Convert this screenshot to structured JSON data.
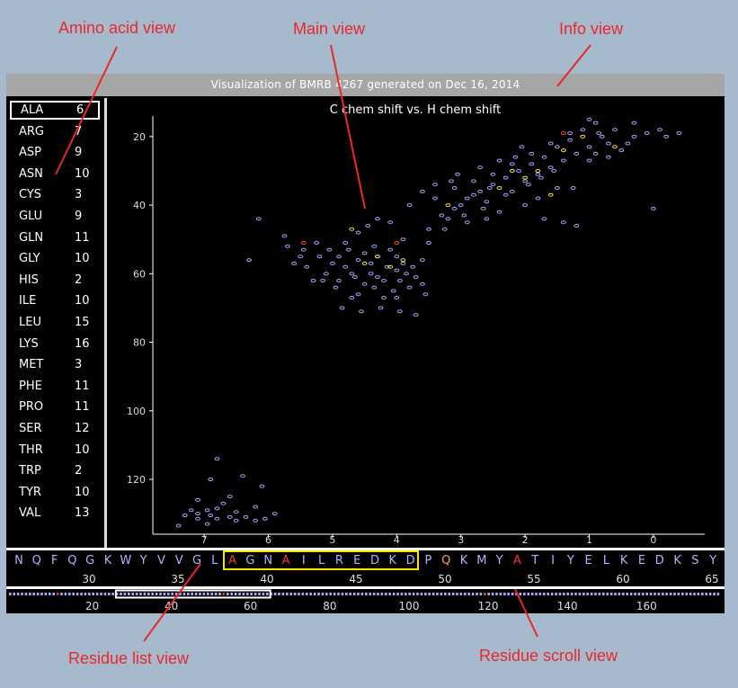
{
  "annotations": {
    "amino_acid_view": "Amino acid view",
    "main_view": "Main view",
    "info_view": "Info view",
    "residue_list_view": "Residue list view",
    "residue_scroll_view": "Residue scroll view"
  },
  "info": {
    "title": "Visualization of BMRB 4267 generated on Dec 16, 2014"
  },
  "amino_acids": [
    {
      "name": "ALA",
      "count": "6",
      "selected": true
    },
    {
      "name": "ARG",
      "count": "7"
    },
    {
      "name": "ASP",
      "count": "9"
    },
    {
      "name": "ASN",
      "count": "10"
    },
    {
      "name": "CYS",
      "count": "3"
    },
    {
      "name": "GLU",
      "count": "9"
    },
    {
      "name": "GLN",
      "count": "11"
    },
    {
      "name": "GLY",
      "count": "10"
    },
    {
      "name": "HIS",
      "count": "2"
    },
    {
      "name": "ILE",
      "count": "10"
    },
    {
      "name": "LEU",
      "count": "15"
    },
    {
      "name": "LYS",
      "count": "16"
    },
    {
      "name": "MET",
      "count": "3"
    },
    {
      "name": "PHE",
      "count": "11"
    },
    {
      "name": "PRO",
      "count": "11"
    },
    {
      "name": "SER",
      "count": "12"
    },
    {
      "name": "THR",
      "count": "10"
    },
    {
      "name": "TRP",
      "count": "2"
    },
    {
      "name": "TYR",
      "count": "10"
    },
    {
      "name": "VAL",
      "count": "13"
    }
  ],
  "chart_data": {
    "type": "scatter",
    "title": "C chem shift vs. H chem shift",
    "xlim": [
      7.8,
      -0.8
    ],
    "ylim": [
      14,
      136
    ],
    "x_ticks": [
      "7",
      "6",
      "5",
      "4",
      "3",
      "2",
      "1",
      "0"
    ],
    "y_ticks": [
      "20",
      "40",
      "60",
      "80",
      "100",
      "120"
    ],
    "colors": {
      "default": "#a8a8ff",
      "highlight": "#ffe34d",
      "selected": "#ff4a2e"
    },
    "series": [
      {
        "values": [
          [
            6.8,
            114
          ],
          [
            6.4,
            119
          ],
          [
            6.9,
            120
          ],
          [
            6.1,
            122
          ],
          [
            6.6,
            125
          ],
          [
            7.1,
            126
          ],
          [
            6.7,
            127
          ],
          [
            6.2,
            128
          ],
          [
            6.8,
            128.5
          ],
          [
            7.2,
            129
          ],
          [
            6.95,
            129
          ],
          [
            6.5,
            129.5
          ],
          [
            7.1,
            130
          ],
          [
            6.9,
            130.5
          ],
          [
            7.3,
            130.5
          ],
          [
            5.9,
            130
          ],
          [
            6.35,
            131
          ],
          [
            6.6,
            131
          ],
          [
            6.8,
            131.5
          ],
          [
            7.1,
            131.5
          ],
          [
            6.05,
            131.5
          ],
          [
            6.2,
            132
          ],
          [
            7.4,
            133.5
          ],
          [
            6.95,
            133
          ],
          [
            6.5,
            132
          ]
        ]
      },
      {
        "values": [
          [
            6.15,
            44
          ],
          [
            5.7,
            52
          ],
          [
            6.3,
            56
          ],
          [
            5.5,
            55
          ],
          [
            5.2,
            55
          ],
          [
            5.0,
            57
          ],
          [
            4.8,
            58
          ],
          [
            4.6,
            56
          ],
          [
            4.4,
            60
          ],
          [
            4.2,
            62
          ],
          [
            4.0,
            59
          ],
          [
            3.8,
            64
          ],
          [
            3.6,
            63
          ],
          [
            4.5,
            54
          ],
          [
            4.3,
            55
          ],
          [
            4.1,
            53
          ],
          [
            3.9,
            57
          ],
          [
            3.7,
            61
          ],
          [
            5.4,
            58
          ],
          [
            5.1,
            60
          ],
          [
            4.9,
            62
          ],
          [
            4.7,
            60
          ],
          [
            4.5,
            63
          ],
          [
            4.3,
            61
          ],
          [
            4.05,
            65
          ],
          [
            3.85,
            60
          ],
          [
            4.6,
            66
          ],
          [
            4.2,
            67
          ],
          [
            3.95,
            62
          ],
          [
            4.4,
            57
          ],
          [
            4.75,
            53
          ],
          [
            5.05,
            53
          ],
          [
            5.3,
            62
          ],
          [
            5.6,
            57
          ],
          [
            4.85,
            70
          ],
          [
            4.55,
            71
          ],
          [
            4.25,
            70
          ],
          [
            3.95,
            71
          ],
          [
            3.7,
            72
          ],
          [
            4.6,
            48
          ],
          [
            4.3,
            44
          ],
          [
            4.1,
            45
          ],
          [
            4.0,
            55
          ],
          [
            3.5,
            51
          ],
          [
            3.6,
            56
          ],
          [
            4.8,
            51
          ],
          [
            4.45,
            46
          ],
          [
            4.95,
            64
          ],
          [
            4.15,
            58
          ],
          [
            3.75,
            58
          ],
          [
            4.65,
            61
          ],
          [
            4.35,
            64
          ],
          [
            3.55,
            66
          ],
          [
            4.0,
            67
          ],
          [
            5.45,
            53
          ],
          [
            5.25,
            51
          ],
          [
            5.75,
            49
          ],
          [
            5.15,
            62
          ],
          [
            4.9,
            55
          ],
          [
            4.7,
            67
          ],
          [
            4.35,
            52
          ],
          [
            3.9,
            50
          ]
        ]
      },
      {
        "values": [
          [
            3.5,
            47
          ],
          [
            3.2,
            44
          ],
          [
            3.0,
            40
          ],
          [
            2.8,
            37
          ],
          [
            2.6,
            39
          ],
          [
            2.4,
            42
          ],
          [
            2.2,
            36
          ],
          [
            2.0,
            33
          ],
          [
            1.8,
            31
          ],
          [
            1.6,
            29
          ],
          [
            1.4,
            27
          ],
          [
            1.2,
            25
          ],
          [
            1.0,
            23
          ],
          [
            0.8,
            20
          ],
          [
            0.6,
            18
          ],
          [
            0.9,
            16
          ],
          [
            1.1,
            18
          ],
          [
            1.3,
            21
          ],
          [
            1.5,
            23
          ],
          [
            1.7,
            26
          ],
          [
            1.9,
            28
          ],
          [
            2.1,
            30
          ],
          [
            2.3,
            32
          ],
          [
            2.5,
            34
          ],
          [
            2.7,
            36
          ],
          [
            2.9,
            38
          ],
          [
            3.1,
            41
          ],
          [
            3.3,
            43
          ],
          [
            3.4,
            38
          ],
          [
            3.1,
            35
          ],
          [
            2.8,
            33
          ],
          [
            2.5,
            31
          ],
          [
            2.2,
            28
          ],
          [
            1.9,
            25
          ],
          [
            1.6,
            22
          ],
          [
            1.3,
            19
          ],
          [
            1.0,
            15
          ],
          [
            0.7,
            22
          ],
          [
            0.5,
            24
          ],
          [
            0.3,
            20
          ],
          [
            0.1,
            19
          ],
          [
            -0.1,
            18
          ],
          [
            -0.2,
            20
          ],
          [
            -0.4,
            19
          ],
          [
            0.0,
            41
          ],
          [
            2.0,
            40
          ],
          [
            1.7,
            44
          ],
          [
            1.4,
            45
          ],
          [
            1.2,
            46
          ],
          [
            1.8,
            38
          ],
          [
            2.3,
            37
          ],
          [
            2.6,
            44
          ],
          [
            2.9,
            45
          ],
          [
            1.5,
            35
          ],
          [
            1.0,
            27
          ],
          [
            0.7,
            26
          ],
          [
            0.4,
            22
          ],
          [
            2.4,
            27
          ],
          [
            2.7,
            29
          ],
          [
            3.05,
            31
          ],
          [
            3.4,
            34
          ],
          [
            3.6,
            36
          ],
          [
            3.8,
            40
          ],
          [
            2.05,
            23
          ],
          [
            1.55,
            30
          ],
          [
            2.95,
            43
          ],
          [
            3.25,
            47
          ],
          [
            0.9,
            25
          ],
          [
            0.3,
            16
          ],
          [
            1.95,
            34
          ],
          [
            2.55,
            35
          ],
          [
            2.15,
            26
          ],
          [
            1.75,
            32
          ],
          [
            3.15,
            33
          ],
          [
            2.65,
            41
          ],
          [
            1.25,
            35
          ],
          [
            0.85,
            19
          ]
        ]
      },
      {
        "kind": "highlight",
        "values": [
          [
            4.7,
            47
          ],
          [
            4.3,
            55
          ],
          [
            4.1,
            58
          ],
          [
            3.9,
            56
          ],
          [
            3.2,
            40
          ],
          [
            2.4,
            35
          ],
          [
            2.2,
            30
          ],
          [
            2.0,
            32
          ],
          [
            1.8,
            30
          ],
          [
            1.4,
            24
          ],
          [
            1.1,
            20
          ],
          [
            0.6,
            23
          ],
          [
            1.6,
            37
          ],
          [
            4.5,
            57
          ]
        ]
      },
      {
        "kind": "selected",
        "values": [
          [
            5.45,
            51
          ],
          [
            4.0,
            51
          ],
          [
            1.4,
            19
          ]
        ]
      }
    ]
  },
  "residue_list": {
    "residues": [
      {
        "code": "N",
        "color": "#b2b2ff"
      },
      {
        "code": "Q",
        "color": "#b2b2ff"
      },
      {
        "code": "F",
        "color": "#b2b2ff"
      },
      {
        "code": "Q",
        "color": "#b2b2ff"
      },
      {
        "code": "G",
        "color": "#b2b2ff"
      },
      {
        "code": "K",
        "color": "#b2b2ff"
      },
      {
        "code": "W",
        "color": "#b2b2ff"
      },
      {
        "code": "Y",
        "color": "#b2b2ff"
      },
      {
        "code": "V",
        "color": "#b2b2ff"
      },
      {
        "code": "V",
        "color": "#b2b2ff"
      },
      {
        "code": "G",
        "color": "#b2b2ff"
      },
      {
        "code": "L",
        "color": "#b2b2ff"
      },
      {
        "code": "A",
        "color": "#ff3030"
      },
      {
        "code": "G",
        "color": "#b2b2ff"
      },
      {
        "code": "N",
        "color": "#b2b2ff"
      },
      {
        "code": "A",
        "color": "#ff3030"
      },
      {
        "code": "I",
        "color": "#b2b2ff"
      },
      {
        "code": "L",
        "color": "#b2b2ff"
      },
      {
        "code": "R",
        "color": "#b2b2ff"
      },
      {
        "code": "E",
        "color": "#b2b2ff"
      },
      {
        "code": "D",
        "color": "#b2b2ff"
      },
      {
        "code": "K",
        "color": "#b2b2ff"
      },
      {
        "code": "D",
        "color": "#b2b2ff"
      },
      {
        "code": "P",
        "color": "#b2b2ff"
      },
      {
        "code": "Q",
        "color": "#ff9a66"
      },
      {
        "code": "K",
        "color": "#b2b2ff"
      },
      {
        "code": "M",
        "color": "#b2b2ff"
      },
      {
        "code": "Y",
        "color": "#b2b2ff"
      },
      {
        "code": "A",
        "color": "#ff3030"
      },
      {
        "code": "T",
        "color": "#b2b2ff"
      },
      {
        "code": "I",
        "color": "#b2b2ff"
      },
      {
        "code": "Y",
        "color": "#b2b2ff"
      },
      {
        "code": "E",
        "color": "#b2b2ff"
      },
      {
        "code": "L",
        "color": "#b2b2ff"
      },
      {
        "code": "K",
        "color": "#b2b2ff"
      },
      {
        "code": "E",
        "color": "#b2b2ff"
      },
      {
        "code": "D",
        "color": "#b2b2ff"
      },
      {
        "code": "K",
        "color": "#b2b2ff"
      },
      {
        "code": "S",
        "color": "#b2b2ff"
      },
      {
        "code": "Y",
        "color": "#b2b2ff"
      }
    ],
    "ticks": [
      "30",
      "35",
      "40",
      "45",
      "50",
      "55",
      "60",
      "65"
    ]
  },
  "residue_scroll": {
    "ticks": [
      "20",
      "40",
      "60",
      "80",
      "100",
      "120",
      "140",
      "160"
    ],
    "window_start": 27,
    "window_end": 66,
    "total": 180
  }
}
